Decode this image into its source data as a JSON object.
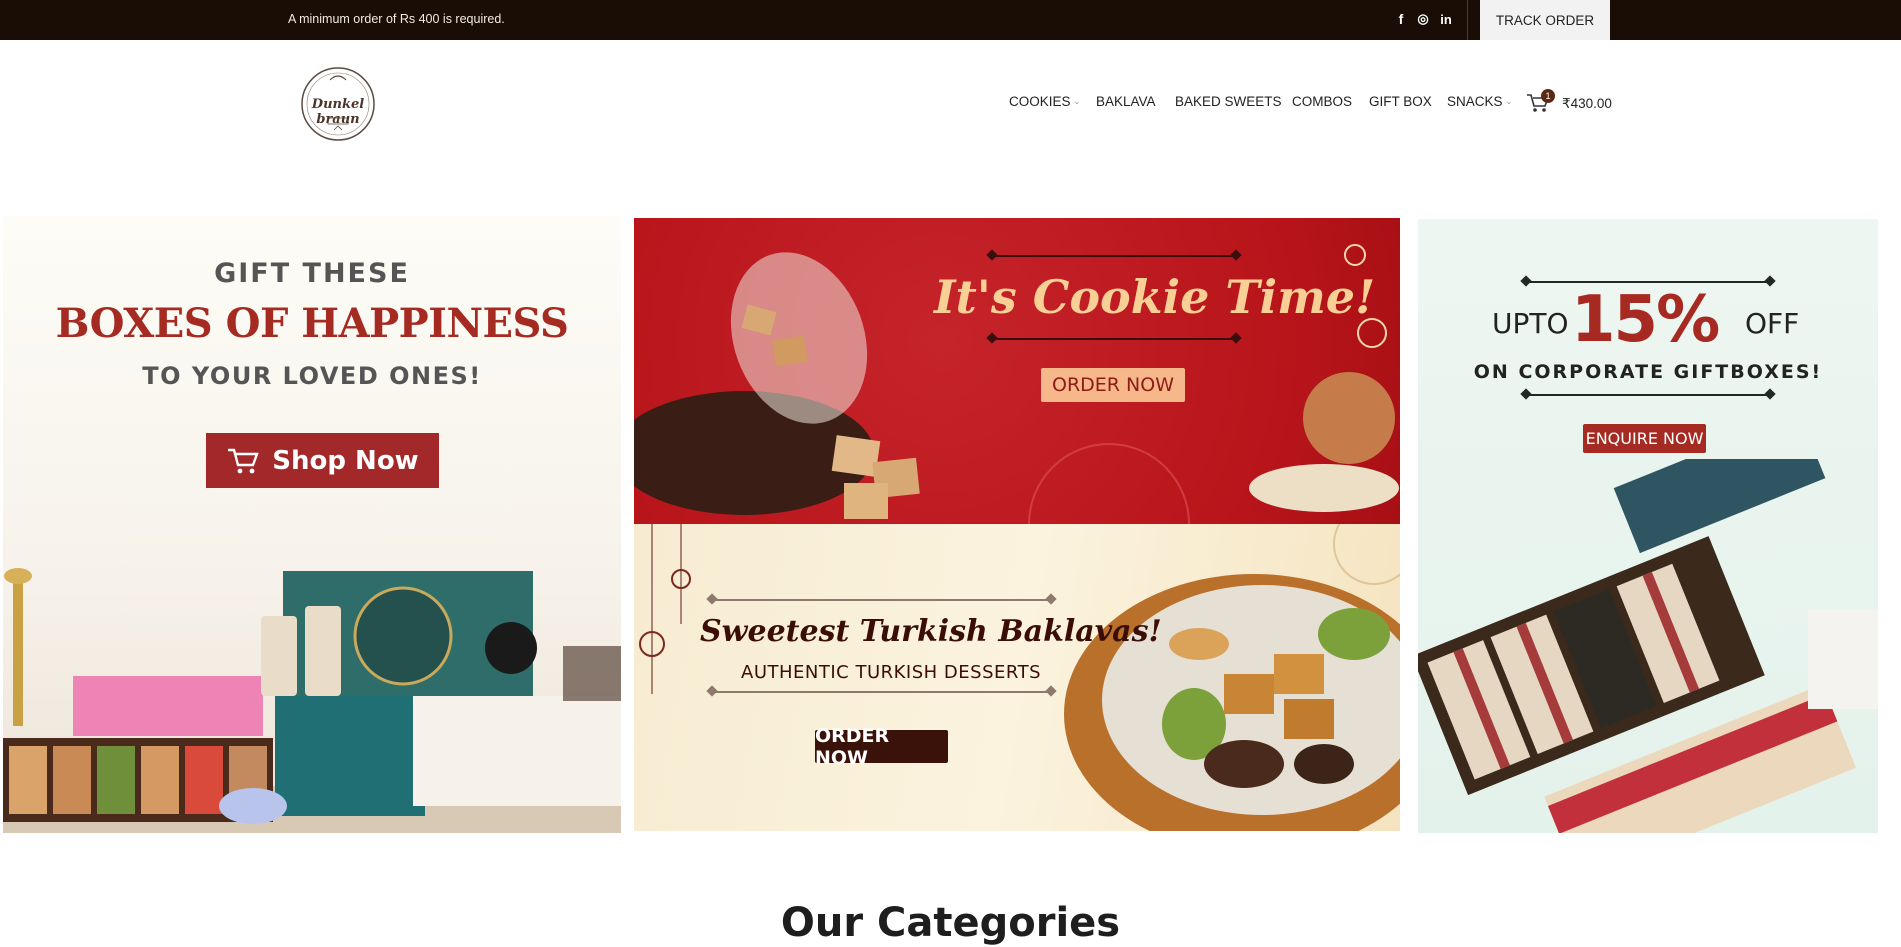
{
  "topbar": {
    "notice": "A minimum order of Rs 400 is required.",
    "social": [
      {
        "icon": "facebook-icon",
        "glyph": "f"
      },
      {
        "icon": "instagram-icon",
        "glyph": "◎"
      },
      {
        "icon": "linkedin-icon",
        "glyph": "in"
      }
    ],
    "track_order": "TRACK ORDER"
  },
  "header": {
    "logo_text": "Dunkel braun",
    "nav": [
      {
        "label": "COOKIES",
        "has_dropdown": true
      },
      {
        "label": "BAKLAVA",
        "has_dropdown": false
      },
      {
        "label": "BAKED SWEETS",
        "has_dropdown": false
      },
      {
        "label": "COMBOS",
        "has_dropdown": false
      },
      {
        "label": "GIFT BOX",
        "has_dropdown": false
      },
      {
        "label": "SNACKS",
        "has_dropdown": true
      }
    ],
    "cart": {
      "count": "1",
      "total": "₹430.00"
    }
  },
  "banners": {
    "gift": {
      "line1": "GIFT THESE",
      "line2": "BOXES OF HAPPINESS",
      "line3": "TO YOUR LOVED ONES!",
      "button": "Shop Now"
    },
    "cookie": {
      "title": "It's Cookie Time!",
      "button": "ORDER NOW"
    },
    "baklava": {
      "title": "Sweetest Turkish Baklavas!",
      "subtitle": "AUTHENTIC TURKISH DESSERTS",
      "button": "ORDER NOW"
    },
    "corporate": {
      "upto": "UPTO",
      "percent": "15%",
      "off": "OFF",
      "line": "ON CORPORATE GIFTBOXES!",
      "button": "ENQUIRE NOW"
    }
  },
  "section_title": "Our Categories",
  "colors": {
    "brand_dark": "#1a0d05",
    "accent_red": "#a52a22",
    "cookie_red": "#b8151b"
  }
}
